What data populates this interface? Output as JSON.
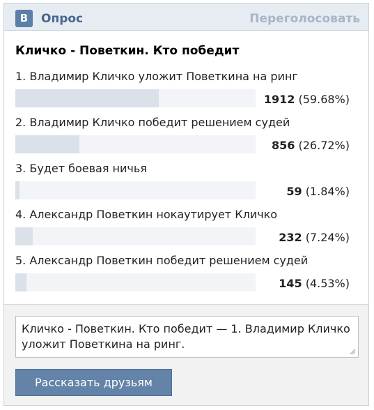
{
  "header": {
    "logo_text": "B",
    "title": "Опрос",
    "revote_label": "Переголосовать"
  },
  "poll": {
    "question": "Кличко - Поветкин. Кто победит",
    "options": [
      {
        "label": "1. Владимир Кличко уложит Поветкина на ринг",
        "count": "1912",
        "percent": "(59.68%)",
        "fraction": 0.5968
      },
      {
        "label": "2. Владимир Кличко победит решением судей",
        "count": "856",
        "percent": "(26.72%)",
        "fraction": 0.2672
      },
      {
        "label": "3. Будет боевая ничья",
        "count": "59",
        "percent": "(1.84%)",
        "fraction": 0.0184
      },
      {
        "label": "4. Александр Поветкин нокаутирует Кличко",
        "count": "232",
        "percent": "(7.24%)",
        "fraction": 0.0724
      },
      {
        "label": "5. Александр Поветкин победит решением судей",
        "count": "145",
        "percent": "(4.53%)",
        "fraction": 0.0453
      }
    ]
  },
  "share": {
    "text": "Кличко - Поветкин. Кто победит — 1. Владимир Кличко уложит Поветкина на ринг.",
    "button_label": "Рассказать друзьям"
  },
  "colors": {
    "header_bg": "#e6ecf2",
    "title": "#45688e",
    "revote": "#a7b6c7",
    "bar_fill": "#dae1e8",
    "button_bg": "#6383a8"
  }
}
